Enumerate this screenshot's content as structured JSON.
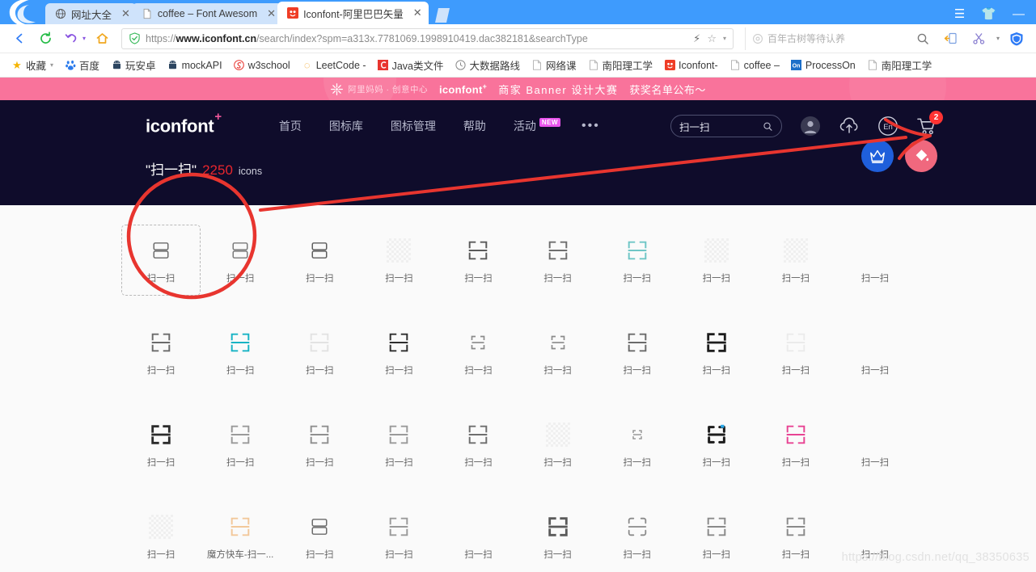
{
  "browser": {
    "tabs": [
      {
        "title": "网址大全",
        "favicon": "globe-icon",
        "active": false
      },
      {
        "title": "coffee – Font Awesom",
        "favicon": "page-icon",
        "active": false
      },
      {
        "title": "Iconfont-阿里巴巴矢量",
        "favicon": "iconfont-icon",
        "active": true
      }
    ],
    "close_label": "✕",
    "url": {
      "prefix": "https://",
      "host": "www.iconfont.cn",
      "path": "/search/index?spm=a313x.7781069.1998910419.dac382181&searchType"
    },
    "omnibox_search_placeholder": "百年古树等待认养",
    "window_controls": [
      "menu-icon",
      "skin-icon",
      "minimize-icon"
    ],
    "toolbar_icons": [
      "back-icon",
      "reload-icon",
      "undo-icon",
      "home-icon",
      "shield-icon",
      "lightning-icon",
      "star-icon",
      "chevron-down-icon",
      "search-icon",
      "mobile-icon",
      "scissors-icon",
      "guard-icon"
    ],
    "bookmarks": [
      {
        "label": "收藏",
        "icon": "star-icon",
        "caret": true
      },
      {
        "label": "百度",
        "icon": "baidu-icon"
      },
      {
        "label": "玩安卓",
        "icon": "android-icon"
      },
      {
        "label": "mockAPI",
        "icon": "android-icon"
      },
      {
        "label": "w3school",
        "icon": "w3school-icon"
      },
      {
        "label": "LeetCode -",
        "icon": "leetcode-icon"
      },
      {
        "label": "Java类文件",
        "icon": "csdn-icon"
      },
      {
        "label": "大数据路线",
        "icon": "clock-icon"
      },
      {
        "label": "网络课",
        "icon": "page-icon"
      },
      {
        "label": "南阳理工学",
        "icon": "page-icon"
      },
      {
        "label": "Iconfont-",
        "icon": "iconfont-icon"
      },
      {
        "label": "coffee –",
        "icon": "page-icon"
      },
      {
        "label": "ProcessOn",
        "icon": "processon-icon"
      },
      {
        "label": "南阳理工学",
        "icon": "page-icon"
      }
    ]
  },
  "promo": {
    "mama_text": "阿里妈妈 · 创意中心",
    "brand": "iconfont",
    "brand_sup": "+",
    "headline": "商家 Banner 设计大赛",
    "cta": "获奖名单公布～"
  },
  "site": {
    "brand": "iconfont",
    "brand_sup": "+",
    "nav": [
      {
        "label": "首页"
      },
      {
        "label": "图标库"
      },
      {
        "label": "图标管理"
      },
      {
        "label": "帮助"
      },
      {
        "label": "活动",
        "badge": "NEW"
      }
    ],
    "more_label": "•••",
    "search_value": "扫一扫",
    "search_placeholder": "扫一扫",
    "right_icons": [
      "avatar-icon",
      "upload-cloud-icon",
      "language-en-icon",
      "cart-icon"
    ],
    "language_label": "En",
    "cart_count": "2"
  },
  "results": {
    "keyword": "\"扫一扫\"",
    "count": "2250",
    "unit": "icons"
  },
  "fabs": [
    {
      "name": "vip-crown-button",
      "color": "#1f5fdb",
      "icon": "crown-icon"
    },
    {
      "name": "color-picker-button",
      "color": "#f0687e",
      "icon": "paint-bucket-icon"
    }
  ],
  "icons": [
    {
      "label": "扫一扫",
      "style": "rounded-split",
      "color": "#6b6b6b",
      "selected": true
    },
    {
      "label": "扫一扫",
      "style": "rounded-split",
      "color": "#7a7a7a"
    },
    {
      "label": "扫一扫",
      "style": "rounded-split",
      "color": "#5e5e5e"
    },
    {
      "label": "扫一扫",
      "style": "placeholder",
      "color": ""
    },
    {
      "label": "扫一扫",
      "style": "corners",
      "color": "#5a5a5a"
    },
    {
      "label": "扫一扫",
      "style": "corners",
      "color": "#6e6e6e"
    },
    {
      "label": "扫一扫",
      "style": "corners",
      "color": "#6fc6c6"
    },
    {
      "label": "扫一扫",
      "style": "placeholder",
      "color": ""
    },
    {
      "label": "扫一扫",
      "style": "placeholder",
      "color": ""
    },
    {
      "label": "扫一扫",
      "style": "blank",
      "color": ""
    },
    {
      "label": "扫一扫",
      "style": "corners",
      "color": "#6b6b6b"
    },
    {
      "label": "扫一扫",
      "style": "corners",
      "color": "#17b3c4"
    },
    {
      "label": "扫一扫",
      "style": "corners",
      "color": "#e2e2e2"
    },
    {
      "label": "扫一扫",
      "style": "corners",
      "color": "#2e2e2e"
    },
    {
      "label": "扫一扫",
      "style": "corners-sm",
      "color": "#8a8a8a"
    },
    {
      "label": "扫一扫",
      "style": "corners-sm",
      "color": "#8a8a8a"
    },
    {
      "label": "扫一扫",
      "style": "corners",
      "color": "#6b6b6b"
    },
    {
      "label": "扫一扫",
      "style": "corners-bold",
      "color": "#1c1c1c"
    },
    {
      "label": "扫一扫",
      "style": "corners",
      "color": "#ebebeb"
    },
    {
      "label": "扫一扫",
      "style": "blank",
      "color": ""
    },
    {
      "label": "扫一扫",
      "style": "corners-bold",
      "color": "#2b2b2b"
    },
    {
      "label": "扫一扫",
      "style": "corners",
      "color": "#9a9a9a"
    },
    {
      "label": "扫一扫",
      "style": "corners",
      "color": "#8f8f8f"
    },
    {
      "label": "扫一扫",
      "style": "corners",
      "color": "#9a9a9a"
    },
    {
      "label": "扫一扫",
      "style": "corners",
      "color": "#6e6e6e"
    },
    {
      "label": "扫一扫",
      "style": "placeholder",
      "color": ""
    },
    {
      "label": "扫一扫",
      "style": "corners-tiny",
      "color": "#8a8a8a"
    },
    {
      "label": "扫一扫",
      "style": "corners-bold-dot",
      "color": "#1c1c1c"
    },
    {
      "label": "扫一扫",
      "style": "corners",
      "color": "#e84393"
    },
    {
      "label": "扫一扫",
      "style": "blank",
      "color": ""
    },
    {
      "label": "扫一扫",
      "style": "placeholder",
      "color": ""
    },
    {
      "label": "魔方快车-扫一...",
      "style": "corners",
      "color": "#f2c89a"
    },
    {
      "label": "扫一扫",
      "style": "rounded-split",
      "color": "#6b6b6b"
    },
    {
      "label": "扫一扫",
      "style": "corners",
      "color": "#9a9a9a"
    },
    {
      "label": "扫一扫",
      "style": "blank",
      "color": ""
    },
    {
      "label": "扫一扫",
      "style": "corners-bold",
      "color": "#5a5a5a"
    },
    {
      "label": "扫一扫",
      "style": "rounded-corners",
      "color": "#8a8a8a"
    },
    {
      "label": "扫一扫",
      "style": "corners",
      "color": "#8a8a8a"
    },
    {
      "label": "扫一扫",
      "style": "corners",
      "color": "#8a8a8a"
    },
    {
      "label": "扫一扫",
      "style": "blank",
      "color": ""
    }
  ],
  "watermark": "https://blog.csdn.net/qq_38350635",
  "colors": {
    "titlebar": "#3e9bfd",
    "promo": "#f9739b",
    "header": "#0f0c2b",
    "accent_red": "#e8262d",
    "grid_bg": "#fafafa",
    "annotation": "#e8352f"
  }
}
